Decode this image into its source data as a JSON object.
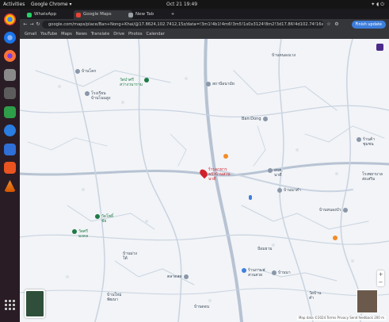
{
  "topbar": {
    "activities": "Activities",
    "app": "Google Chrome ▾",
    "clock": "Oct 21 19:49",
    "status": "✦ ◖ ⏻"
  },
  "tabs": [
    {
      "label": "WhatsApp",
      "color": "#25d366"
    },
    {
      "label": "Google Maps",
      "color": "#ea4335"
    },
    {
      "label": "New Tab",
      "color": "#9aa0a6"
    }
  ],
  "browser": {
    "url": "google.com/maps/place/Ban+Nong+Khai/@17.8624,102.7412,15z/data=!3m1!4b1!4m6!3m5!1s0x3124!8m2!3d17.86!4d102.74!16s",
    "account_button": "Finish update",
    "bookmarks": [
      "Gmail",
      "YouTube",
      "Maps",
      "News",
      "Translate",
      "Drive",
      "Photos",
      "Calendar"
    ]
  },
  "map": {
    "selected_place": "ร้านอาหาร\nครัวบ้านสวน\nนาดี",
    "pois": [
      {
        "label": "บ้านโคก",
        "kind": "default"
      },
      {
        "label": "วัดป่าศรี\nสว่างวนาราม",
        "kind": "green"
      },
      {
        "label": "โรงเรียน\nบ้านโนนสูง",
        "kind": "default"
      },
      {
        "label": "สถานีอนามัย",
        "kind": "default"
      },
      {
        "label": "บ้านหนองแวง",
        "kind": "default"
      },
      {
        "label": "Ban Dong",
        "kind": "default"
      },
      {
        "label": "ร้านค้า\nชุมชน",
        "kind": "default"
      },
      {
        "label": "อบต.\nนาดี",
        "kind": "default"
      },
      {
        "label": "บ้านนาคำ",
        "kind": "default"
      },
      {
        "label": "วัดโพธิ์\nชัย",
        "kind": "green"
      },
      {
        "label": "วัดศรี\nมงคล",
        "kind": "green"
      },
      {
        "label": "บ้านม่วง\nใต้",
        "kind": "default"
      },
      {
        "label": "ตลาดสด",
        "kind": "default"
      },
      {
        "label": "บ้านหนองบัว",
        "kind": "default"
      },
      {
        "label": "โรงพยาบาล\nส่งเสริม",
        "kind": "default"
      },
      {
        "label": "ร้านกาแฟ\nสวนสวย",
        "kind": "default"
      },
      {
        "label": "บ้านนา",
        "kind": "default"
      },
      {
        "label": "ป้อมยาม",
        "kind": "default"
      },
      {
        "label": "บ้านใหม่\nพัฒนา",
        "kind": "default"
      },
      {
        "label": "บ้านดอน",
        "kind": "default"
      },
      {
        "label": "วัดบ้าน\nคำ",
        "kind": "default"
      }
    ],
    "attribution": "Map data ©2024  Terms  Privacy  Send feedback  200 m"
  },
  "colors": {
    "map_bg": "#f2f4f7",
    "road": "#c9d3e0",
    "major_road": "#b7c3d3",
    "pin_red": "#d0202a",
    "poi_green": "#1e7a45",
    "poi_orange": "#f28c28"
  }
}
